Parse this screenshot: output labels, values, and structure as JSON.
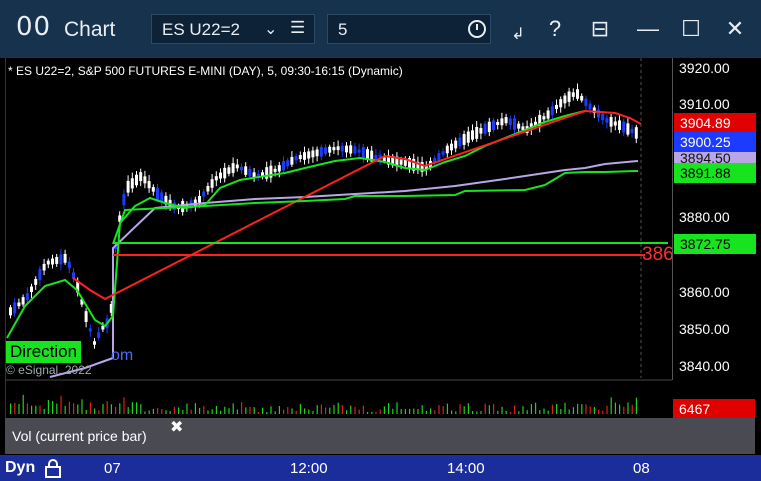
{
  "titlebar": {
    "logo": "00",
    "title": "Chart",
    "symbol": "ES U22=2",
    "interval": "5",
    "icons": [
      "chevron-down-icon",
      "menu-icon",
      "clock-icon",
      "draw-icon",
      "help-icon",
      "layout-icon",
      "minimize-icon",
      "maximize-icon",
      "close-icon"
    ]
  },
  "study": {
    "title": "* ES U22=2, S&P 500 FUTURES E-MINI (DAY), 5, 09:30-16:15 (Dynamic)",
    "direction_label": "Direction",
    "url_fragment": "om",
    "copyright": "© eSignal, 2022",
    "side_label": "386"
  },
  "price_axis": {
    "ticks": [
      "3920.00",
      "3910.00",
      "3880.00",
      "3860.00",
      "3850.00",
      "3840.00"
    ],
    "tags": [
      {
        "value": "3904.89",
        "bg": "#e00000",
        "fg": "#ffffff"
      },
      {
        "value": "3900.25",
        "bg": "#1d3bff",
        "fg": "#ffffff"
      },
      {
        "value": "3894.50",
        "bg": "#b9a6e6",
        "fg": "#111111"
      },
      {
        "value": "3891.88",
        "bg": "#17e41f",
        "fg": "#000000"
      },
      {
        "value": "3872.75",
        "bg": "#17e41f",
        "fg": "#000000"
      }
    ]
  },
  "volume": {
    "value": "6467",
    "label": "Vol (current price bar)",
    "close_icon": "✖"
  },
  "time_axis": {
    "mode": "Dyn",
    "ticks": [
      "07",
      "12:00",
      "14:00",
      "08"
    ]
  },
  "colors": {
    "up_candle": "#ffffff",
    "down_candle": "#1d3bff",
    "ma_fast": "#17e41f",
    "ma_slow": "#b9a6e6",
    "ma_red": "#ff2020",
    "level_green": "#17e41f",
    "level_red": "#ff2020"
  }
}
